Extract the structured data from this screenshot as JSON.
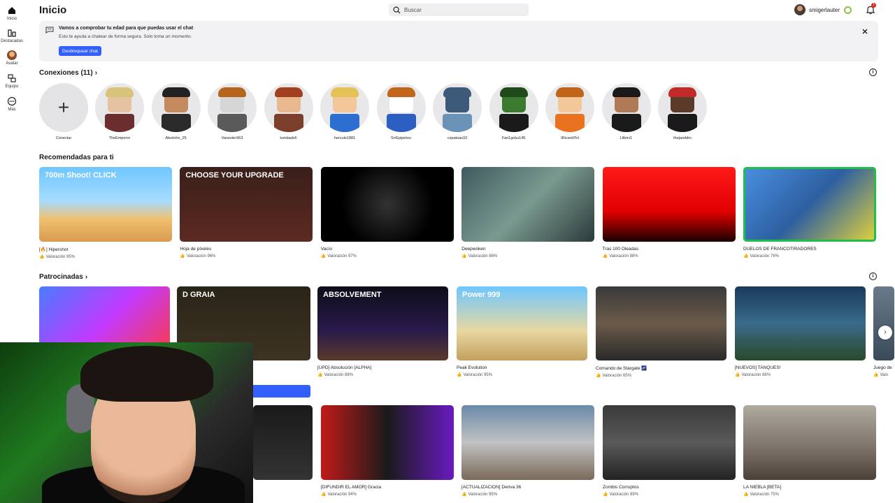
{
  "nav": [
    {
      "label": "Inicio",
      "icon": "home-icon"
    },
    {
      "label": "Destacadas",
      "icon": "charts-icon"
    },
    {
      "label": "Avatar",
      "icon": "avatar-icon"
    },
    {
      "label": "Equipo",
      "icon": "groups-icon"
    },
    {
      "label": "Más",
      "icon": "more-icon"
    }
  ],
  "header": {
    "title": "Inicio",
    "search_placeholder": "Buscar",
    "username": "smigerlauter",
    "notification_count": "1"
  },
  "banner": {
    "title": "Vamos a comprobar tu edad para que puedas usar el chat",
    "subtitle": "Esto te ayuda a chatear de forma segura. Solo toma un momento.",
    "button": "Desbloquear chat"
  },
  "connections": {
    "title": "Conexiones (11)",
    "add_label": "Conectar",
    "friends": [
      {
        "name": "TheEmperor",
        "skin": "#e6c3a0",
        "hair": "#d9c27a",
        "shirt": "#6b2d2d"
      },
      {
        "name": "Alexinho_25",
        "skin": "#c48a5e",
        "hair": "#222222",
        "shirt": "#2b2b2b"
      },
      {
        "name": "Vanester963",
        "skin": "#d6d6d6",
        "hair": "#b5651d",
        "shirt": "#5a5a5a"
      },
      {
        "name": "tumbadx6",
        "skin": "#e8b88f",
        "hair": "#a0401f",
        "shirt": "#7a3e2b"
      },
      {
        "name": "hercule1881",
        "skin": "#f3c79a",
        "hair": "#e4c256",
        "shirt": "#2d6fd1"
      },
      {
        "name": "SrrEpipetoo",
        "skin": "#ffffff",
        "hair": "#c0651a",
        "shirt": "#2d5fc2"
      },
      {
        "name": "czpatoas33",
        "skin": "#3d5a7a",
        "hair": "#3d5a7a",
        "shirt": "#6b93b8"
      },
      {
        "name": "Fan1goku145",
        "skin": "#3c7a2e",
        "hair": "#1f4a1a",
        "shirt": "#1a1a1a"
      },
      {
        "name": "IRicardiTol",
        "skin": "#f3c79a",
        "hair": "#c0651a",
        "shirt": "#e8721f"
      },
      {
        "name": "Llibrix1",
        "skin": "#b07a56",
        "hair": "#1a1a1a",
        "shirt": "#1a1a1a"
      },
      {
        "name": "thejanddm",
        "skin": "#5a3b2a",
        "hair": "#c22a2a",
        "shirt": "#1a1a1a"
      }
    ]
  },
  "recommended": {
    "title": "Recomendadas para ti",
    "games": [
      {
        "name": "[🔥] Hipershot",
        "rating": "Valoración 95%",
        "bg": "linear-gradient(180deg,#6ec6ff 0%,#a6dcff 45%,#f0c070 70%,#d99a4e 100%)",
        "overlay": "700m Shoot! CLICK"
      },
      {
        "name": "Hoja de píxeles",
        "rating": "Valoración 96%",
        "bg": "linear-gradient(180deg,#3a1f1a 0%,#5c2a22 100%)",
        "overlay": "CHOOSE YOUR UPGRADE"
      },
      {
        "name": "Vacío",
        "rating": "Valoración 97%",
        "bg": "radial-gradient(circle at 50% 50%,#333 0%,#000 60%)",
        "overlay": ""
      },
      {
        "name": "Deepwoken",
        "rating": "Valoración 86%",
        "bg": "linear-gradient(135deg,#3f5a5e 0%,#7a9a90 50%,#2c3a3a 100%)",
        "overlay": ""
      },
      {
        "name": "Tras 100 Oleadas",
        "rating": "Valoración 98%",
        "bg": "linear-gradient(180deg,#ff1a1a 0%,#e00000 60%,#1a0000 100%)",
        "overlay": ""
      },
      {
        "name": "DUELOS DE FRANCOTIRADORES",
        "rating": "Valoración 76%",
        "bg": "linear-gradient(135deg,#4a90e2 0%,#2d5fa0 50%,#e4d43a 100%)",
        "overlay": ""
      }
    ]
  },
  "sponsored": {
    "title": "Patrocinadas",
    "games": [
      {
        "name": "",
        "rating": "",
        "bg": "linear-gradient(135deg,#4a7bff 0%,#c23aff 50%,#ff3a3a 100%)",
        "overlay": ""
      },
      {
        "name": "",
        "rating": "",
        "bg": "linear-gradient(180deg,#2a2418 0%,#3d3322 100%)",
        "overlay": "D GRAIA"
      },
      {
        "name": "[UPD] Absolución [ALPHA]",
        "rating": "Valoración 88%",
        "bg": "linear-gradient(180deg,#0d0d1a 0%,#2a1a4a 60%,#5a3a2a 100%)",
        "overlay": "ABSOLVEMENT"
      },
      {
        "name": "Peak Evolution",
        "rating": "Valoración 95%",
        "bg": "linear-gradient(180deg,#6ec6ff 0%,#e8d8a0 60%,#c2a060 100%)",
        "overlay": "Power 999"
      },
      {
        "name": "Comando de Stargate 🌌",
        "rating": "Valoración 65%",
        "bg": "linear-gradient(180deg,#3a3a3a 0%,#6b5a4a 50%,#2a2a2a 100%)",
        "overlay": ""
      },
      {
        "name": "[NUEVOS] TANQUES!",
        "rating": "Valoración 88%",
        "bg": "linear-gradient(180deg,#1a3a5a 0%,#3a6a8a 50%,#2a4a2a 100%)",
        "overlay": ""
      },
      {
        "name": "Juego de",
        "rating": "Valo",
        "bg": "linear-gradient(180deg,#6a7a8a 0%,#3a4a5a 100%)",
        "overlay": ""
      }
    ]
  },
  "more_games": [
    {
      "name": "",
      "rating": "",
      "bg": "linear-gradient(180deg,#1a1a1a 0%,#333333 100%)"
    },
    {
      "name": "[DIFUNDIR EL AMOR] Gracia",
      "rating": "Valoración 94%",
      "bg": "linear-gradient(90deg,#c21a1a 0%,#1a1a1a 50%,#6a1ac2 100%)"
    },
    {
      "name": "[ACTUALIZACIÓN] Deriva 36",
      "rating": "Valoración 95%",
      "bg": "linear-gradient(180deg,#6a8aaa 0%,#c2c2c2 50%,#7a6a5a 100%)"
    },
    {
      "name": "Zombis Corruptos",
      "rating": "Valoración 89%",
      "bg": "linear-gradient(180deg,#3a3a3a 0%,#5a5a5a 50%,#222222 100%)"
    },
    {
      "name": "LA NIEBLA [BETA]",
      "rating": "Valoración 75%",
      "bg": "linear-gradient(180deg,#b0aaa0 0%,#7a7068 60%,#4a4038 100%)"
    }
  ]
}
